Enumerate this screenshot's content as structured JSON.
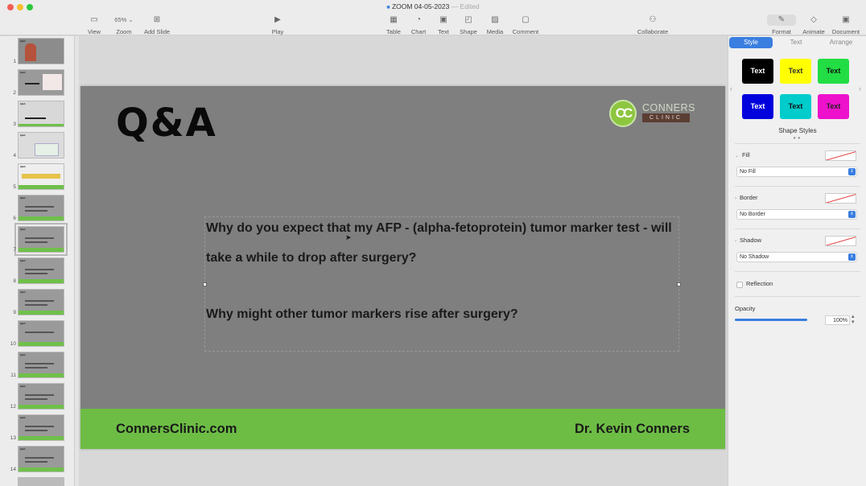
{
  "window": {
    "title": "ZOOM 04-05-2023",
    "status": "Edited",
    "separator": "—"
  },
  "toolbar": {
    "view": "View",
    "zoom_value": "65%",
    "zoom": "Zoom",
    "add_slide": "Add Slide",
    "play": "Play",
    "table": "Table",
    "chart": "Chart",
    "text": "Text",
    "shape": "Shape",
    "media": "Media",
    "comment": "Comment",
    "collaborate": "Collaborate",
    "format": "Format",
    "animate": "Animate",
    "document": "Document"
  },
  "sidebar": {
    "slide_numbers": [
      "1",
      "2",
      "3",
      "4",
      "5",
      "6",
      "7",
      "8",
      "9",
      "10",
      "11",
      "12",
      "13",
      "14"
    ],
    "selected_slide": "7"
  },
  "slide": {
    "title": "Q&A",
    "logo": {
      "initials": "CC",
      "name": "CONNERS",
      "sub": "CLINIC"
    },
    "question1": "Why do you expect that my AFP  - (alpha-fetoprotein) tumor marker test - will take a while to drop after surgery?",
    "question2": "Why might other tumor markers rise after surgery?",
    "footer_left": "ConnersClinic.com",
    "footer_right": "Dr. Kevin Conners",
    "footer_color": "#6dbd45",
    "background_color": "#7f7f7f"
  },
  "inspector": {
    "tabs": [
      "Style",
      "Text",
      "Arrange"
    ],
    "active_tab": "Style",
    "style_tiles": [
      {
        "label": "Text",
        "bg": "#000000",
        "fg": "#ffffff"
      },
      {
        "label": "Text",
        "bg": "#ffff00",
        "fg": "#333333"
      },
      {
        "label": "Text",
        "bg": "#22dd44",
        "fg": "#111111"
      },
      {
        "label": "Text",
        "bg": "#0000dd",
        "fg": "#ffffff"
      },
      {
        "label": "Text",
        "bg": "#00cccc",
        "fg": "#111111"
      },
      {
        "label": "Text",
        "bg": "#ee11cc",
        "fg": "#222222"
      }
    ],
    "shape_styles_label": "Shape Styles",
    "fill": {
      "label": "Fill",
      "value": "No Fill"
    },
    "border": {
      "label": "Border",
      "value": "No Border"
    },
    "shadow": {
      "label": "Shadow",
      "value": "No Shadow"
    },
    "reflection_label": "Reflection",
    "reflection_checked": false,
    "opacity_label": "Opacity",
    "opacity_value": "100%",
    "opacity_fraction": 1.0
  },
  "colors": {
    "accent": "#3a7ee0",
    "logo_green": "#8dc63f",
    "logo_brown": "#5b3e33"
  }
}
